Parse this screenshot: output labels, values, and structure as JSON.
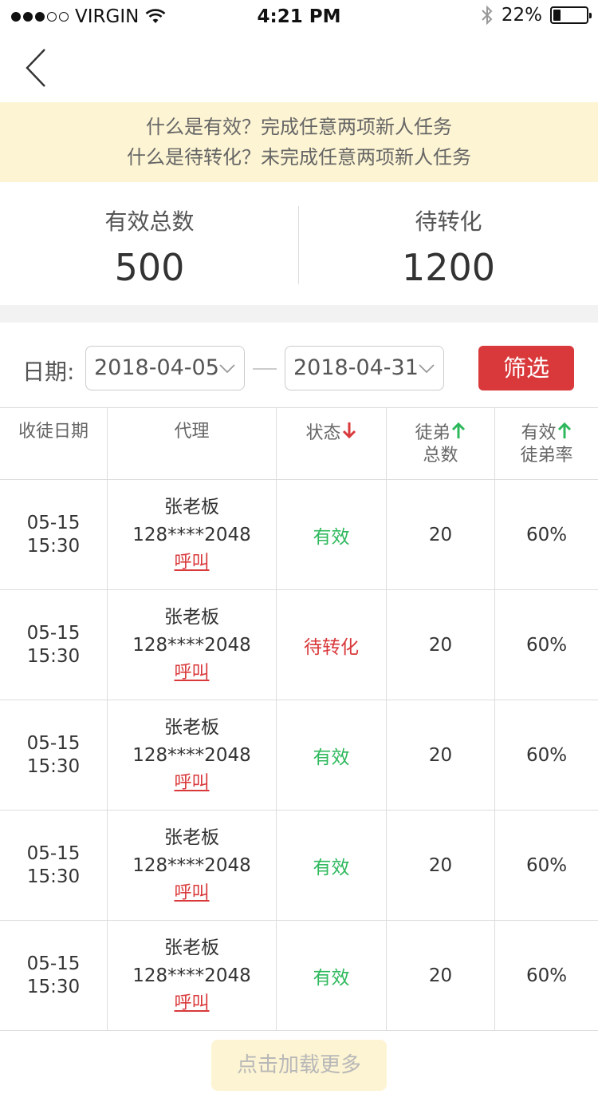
{
  "status_bar": {
    "carrier": "VIRGIN",
    "time": "4:21 PM",
    "battery": "22%",
    "battery_level": 0.22,
    "icons": [
      "signal-dots",
      "wifi-icon",
      "bluetooth-icon",
      "battery-icon"
    ]
  },
  "nav": {
    "back_icon": "chevron-left-icon"
  },
  "notice": {
    "line1": "什么是有效？完成任意两项新人任务",
    "line2": "什么是待转化？未完成任意两项新人任务"
  },
  "summary": {
    "valid_label": "有效总数",
    "valid_value": "500",
    "pending_label": "待转化",
    "pending_value": "1200"
  },
  "filter": {
    "label": "日期:",
    "start_date": "2018-04-05",
    "end_date": "2018-04-31",
    "button": "筛选"
  },
  "table": {
    "headers": {
      "date": "收徒日期",
      "agent": "代理",
      "status": "状态",
      "total_line1": "徒弟",
      "total_line2": "总数",
      "rate_line1": "有效",
      "rate_line2": "徒弟率"
    },
    "rows": [
      {
        "date": "05-15",
        "time": "15:30",
        "name": "张老板",
        "phone": "128****2048",
        "call": "呼叫",
        "status": "有效",
        "total": "20",
        "rate": "60%"
      },
      {
        "date": "05-15",
        "time": "15:30",
        "name": "张老板",
        "phone": "128****2048",
        "call": "呼叫",
        "status": "待转化",
        "total": "20",
        "rate": "60%"
      },
      {
        "date": "05-15",
        "time": "15:30",
        "name": "张老板",
        "phone": "128****2048",
        "call": "呼叫",
        "status": "有效",
        "total": "20",
        "rate": "60%"
      },
      {
        "date": "05-15",
        "time": "15:30",
        "name": "张老板",
        "phone": "128****2048",
        "call": "呼叫",
        "status": "有效",
        "total": "20",
        "rate": "60%"
      },
      {
        "date": "05-15",
        "time": "15:30",
        "name": "张老板",
        "phone": "128****2048",
        "call": "呼叫",
        "status": "有效",
        "total": "20",
        "rate": "60%"
      }
    ]
  },
  "load_more": "点击加载更多",
  "colors": {
    "accent_red": "#d9393b",
    "valid_green": "#2eb85c",
    "notice_bg": "#fdf4d3"
  }
}
